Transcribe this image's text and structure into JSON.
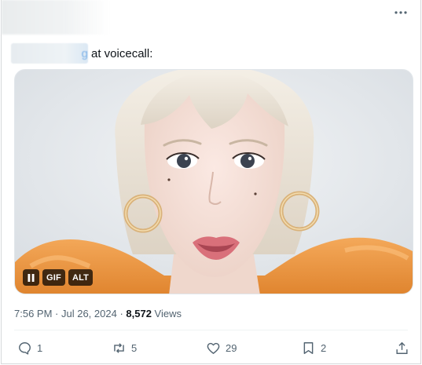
{
  "post": {
    "text_after_mention": "at voicecall:",
    "mention_visible_tail": "g",
    "media": {
      "type": "gif",
      "badges": {
        "pause_icon": "pause-icon",
        "gif_label": "GIF",
        "alt_label": "ALT"
      }
    },
    "meta": {
      "time": "7:56 PM",
      "separator": " · ",
      "date": "Jul 26, 2024",
      "views_count": "8,572",
      "views_label": " Views"
    },
    "actions": {
      "replies": "1",
      "reposts": "5",
      "likes": "29",
      "bookmarks": "2"
    }
  },
  "icons": {
    "more": "more-horizontal-icon",
    "reply": "reply-icon",
    "repost": "repost-icon",
    "like": "heart-icon",
    "bookmark": "bookmark-icon",
    "share": "share-icon"
  },
  "colors": {
    "text_primary": "#0f1419",
    "text_secondary": "#536471",
    "border": "#d6d9db",
    "link_blur": "#7fb3e8",
    "badge_bg": "#000000"
  }
}
